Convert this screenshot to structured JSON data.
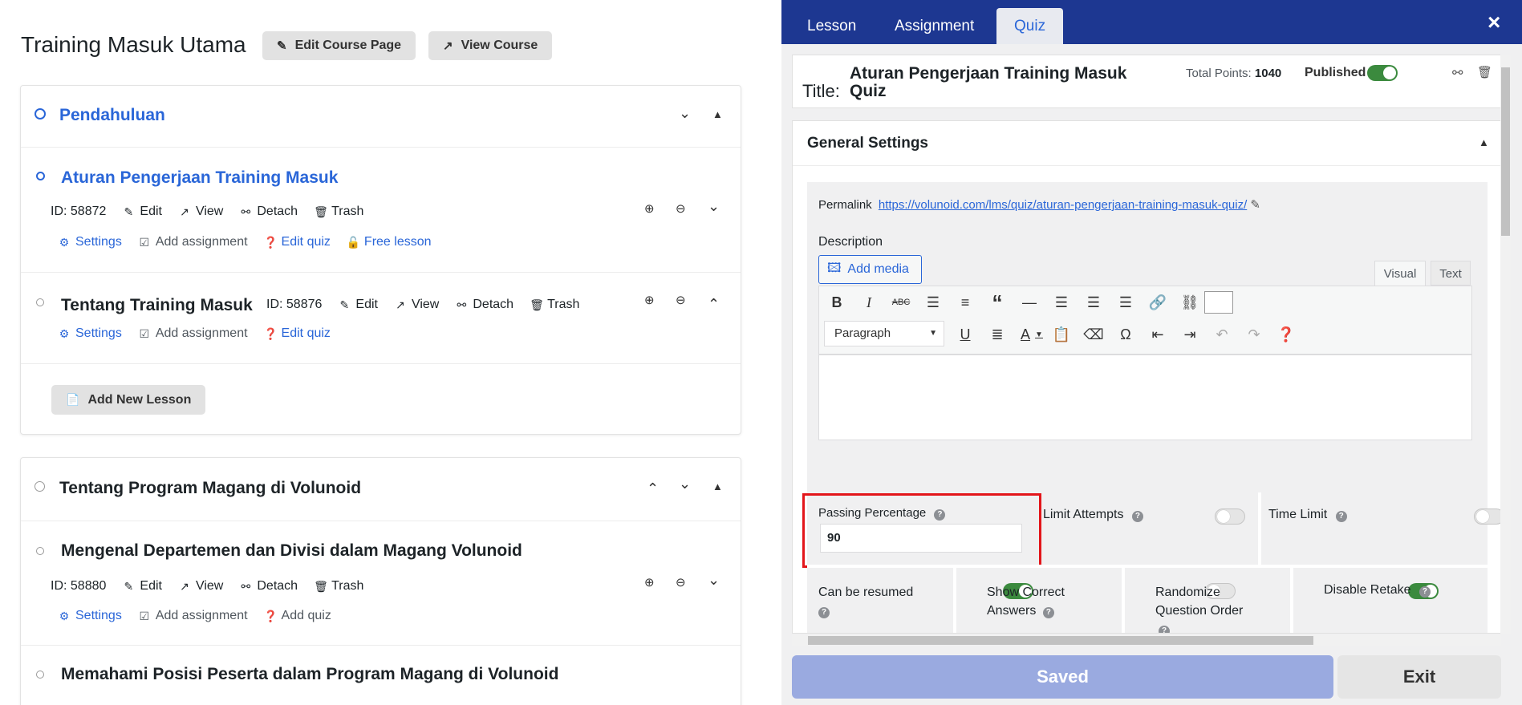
{
  "course": {
    "title": "Training Masuk Utama",
    "edit_page_label": "Edit Course Page",
    "view_course_label": "View Course"
  },
  "sections": [
    {
      "title": "Pendahuluan",
      "lessons": [
        {
          "title": "Aturan Pengerjaan Training Masuk",
          "id_label": "ID: 58872",
          "actions": [
            "Edit",
            "View",
            "Detach",
            "Trash"
          ],
          "links": [
            "Settings",
            "Add assignment",
            "Edit quiz",
            "Free lesson"
          ]
        },
        {
          "title": "Tentang Training Masuk",
          "id_label": "ID: 58876",
          "actions": [
            "Edit",
            "View",
            "Detach",
            "Trash"
          ],
          "links": [
            "Settings",
            "Add assignment",
            "Edit quiz"
          ]
        }
      ],
      "add_lesson_label": "Add New Lesson"
    },
    {
      "title": "Tentang Program Magang di Volunoid",
      "lessons": [
        {
          "title": "Mengenal Departemen dan Divisi dalam Magang Volunoid",
          "id_label": "ID: 58880",
          "actions": [
            "Edit",
            "View",
            "Detach",
            "Trash"
          ],
          "links": [
            "Settings",
            "Add assignment",
            "Add quiz"
          ]
        },
        {
          "title": "Memahami Posisi Peserta dalam Program Magang di Volunoid"
        }
      ]
    }
  ],
  "panel": {
    "tabs": [
      "Lesson",
      "Assignment",
      "Quiz"
    ],
    "active_tab": "Quiz",
    "close_glyph": "×",
    "title_label": "Title:",
    "quiz_title_line1": "Aturan Pengerjaan Training Masuk",
    "quiz_title_line2": "Quiz",
    "total_points_label": "Total Points:",
    "total_points_value": "1040",
    "published_label": "Published",
    "general_settings_label": "General Settings",
    "permalink_label": "Permalink",
    "permalink_url": "https://volunoid.com/lms/quiz/aturan-pengerjaan-training-masuk-quiz/",
    "description_label": "Description",
    "add_media_label": "Add media",
    "visual_tab": "Visual",
    "text_tab": "Text",
    "paragraph_select": "Paragraph",
    "passing_percentage_label": "Passing Percentage",
    "passing_percentage_value": "90",
    "limit_attempts_label": "Limit Attempts",
    "time_limit_label": "Time Limit",
    "can_be_resumed_label": "Can be resumed",
    "show_correct_answers_label": "Show Correct Answers",
    "randomize_label": "Randomize Question Order",
    "disable_retake_label": "Disable Retake",
    "saved_label": "Saved",
    "exit_label": "Exit",
    "highlight_color": "#e3151a",
    "accent_color": "#1d3791"
  }
}
